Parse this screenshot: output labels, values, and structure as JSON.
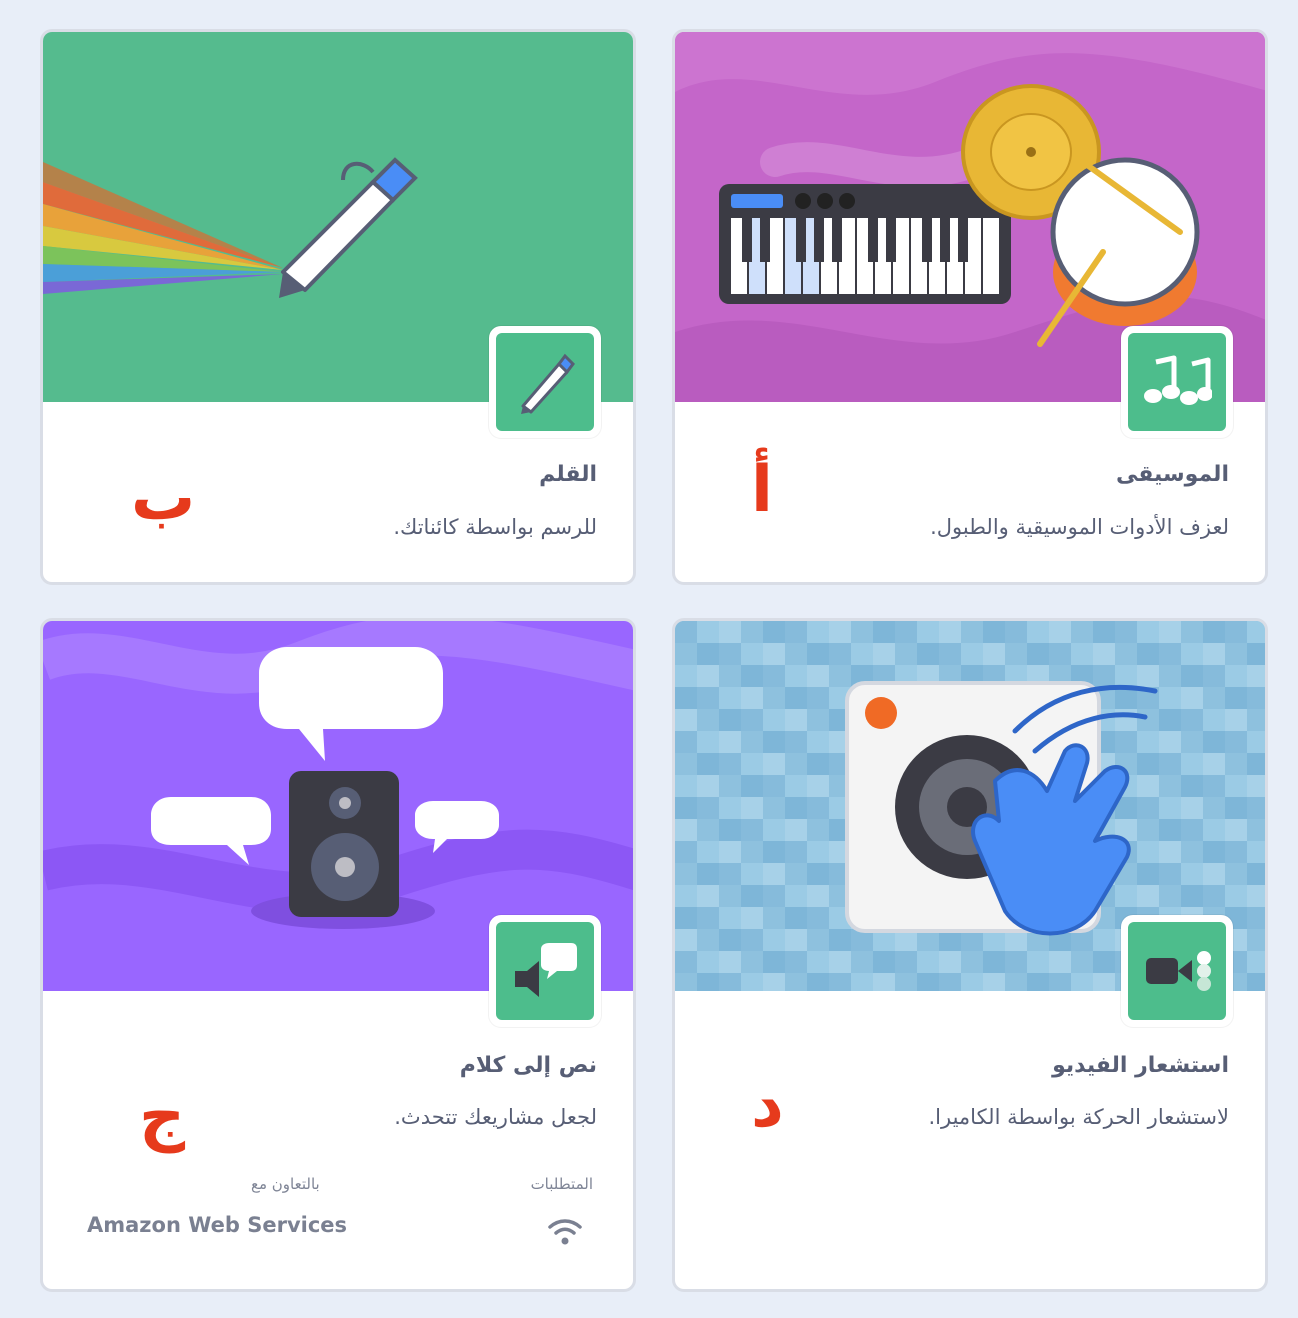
{
  "extensions": [
    {
      "id": "music",
      "title": "الموسيقى",
      "description": "لعزف الأدوات الموسيقية والطبول.",
      "letter": "أ",
      "icon": "music-notes-icon",
      "banner_color": "#c466c9"
    },
    {
      "id": "pen",
      "title": "القلم",
      "description": "للرسم بواسطة كائناتك.",
      "letter": "ب",
      "icon": "pen-icon",
      "banner_color": "#55bb8e"
    },
    {
      "id": "video",
      "title": "استشعار الفيديو",
      "description": "لاستشعار الحركة بواسطة الكاميرا.",
      "letter": "د",
      "icon": "video-camera-icon",
      "banner_color": "#8ec1de"
    },
    {
      "id": "tts",
      "title": "نص إلى كلام",
      "description": "لجعل مشاريعك تتحدث.",
      "letter": "ج",
      "icon": "speech-bubble-icon",
      "banner_color": "#9966ff",
      "requirements_label": "المتطلبات",
      "requirements_icon": "wifi-icon",
      "collaboration_label": "بالتعاون مع",
      "collaborator": "Amazon Web Services"
    }
  ],
  "colors": {
    "page_background": "#e8eef8",
    "icon_tile": "#4dbd8c",
    "letter": "#e63a1c",
    "text": "#575e75"
  }
}
